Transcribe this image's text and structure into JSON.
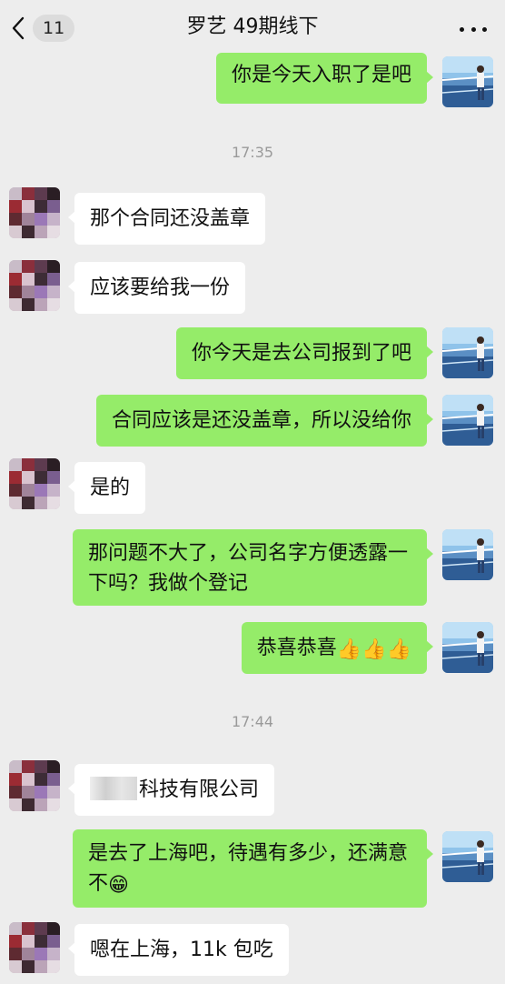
{
  "header": {
    "unread_count": "11",
    "title": "罗艺  49期线下"
  },
  "timestamps": [
    "17:35",
    "17:44"
  ],
  "messages": [
    {
      "from": "me",
      "text": "你是今天入职了是吧"
    },
    {
      "from": "them",
      "text": "那个合同还没盖章"
    },
    {
      "from": "them",
      "text": "应该要给我一份"
    },
    {
      "from": "me",
      "text": "你今天是去公司报到了吧"
    },
    {
      "from": "me",
      "text": "合同应该是还没盖章，所以没给你"
    },
    {
      "from": "them",
      "text": "是的"
    },
    {
      "from": "me",
      "text": "那问题不大了，公司名字方便透露一下吗？我做个登记"
    },
    {
      "from": "me",
      "text": "恭喜恭喜",
      "emoji": "👍👍👍"
    },
    {
      "from": "them",
      "text": "科技有限公司"
    },
    {
      "from": "me",
      "text": "是去了上海吧，待遇有多少，还满意不",
      "emoji": "😁"
    },
    {
      "from": "them",
      "text": "嗯在上海，11k 包吃"
    }
  ],
  "colors": {
    "background": "#ededed",
    "my_bubble": "#95ec69",
    "their_bubble": "#ffffff",
    "timestamp": "#9a9a9a"
  },
  "icons": {
    "back": "chevron-left-icon",
    "more": "more-dots-icon"
  }
}
